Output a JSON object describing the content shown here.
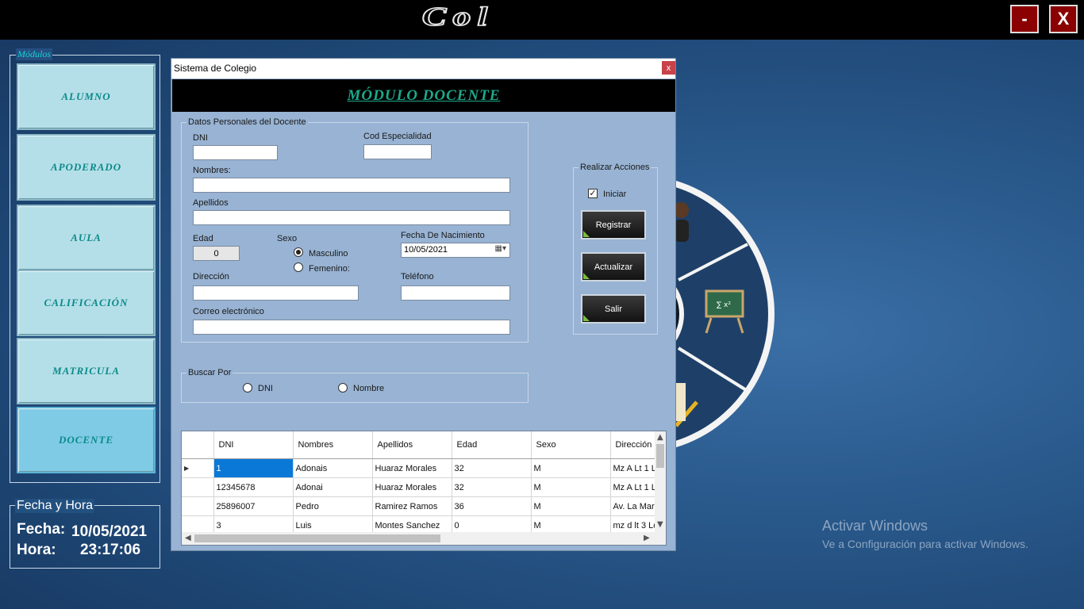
{
  "app": {
    "logo_text": "Col",
    "minimize_label": "-",
    "close_label": "X"
  },
  "sidebar": {
    "legend": "Módulos",
    "items": [
      {
        "label": "ALUMNO"
      },
      {
        "label": "APODERADO"
      },
      {
        "label": "AULA"
      },
      {
        "label": "CALIFICACIÓN"
      },
      {
        "label": "MATRICULA"
      },
      {
        "label": "DOCENTE"
      }
    ]
  },
  "datetime": {
    "legend": "Fecha y Hora",
    "date_label": "Fecha:",
    "date_value": "10/05/2021",
    "time_label": "Hora:",
    "time_value": "23:17:06"
  },
  "watermark": {
    "line1": "Activar Windows",
    "line2": "Ve a Configuración para activar Windows."
  },
  "dialog": {
    "title": "Sistema de Colegio",
    "close_label": "x",
    "banner": "MÓDULO DOCENTE",
    "personal": {
      "legend": "Datos Personales del Docente",
      "dni_label": "DNI",
      "dni_value": "",
      "cod_label": "Cod Especialidad",
      "cod_value": "",
      "nombres_label": "Nombres:",
      "nombres_value": "",
      "apellidos_label": "Apellidos",
      "apellidos_value": "",
      "edad_label": "Edad",
      "edad_value": "0",
      "sexo_label": "Sexo",
      "masculino_label": "Masculino",
      "femenino_label": "Femenino:",
      "fecha_label": "Fecha De Nacimiento",
      "fecha_value": "10/05/2021",
      "direccion_label": "Dirección",
      "direccion_value": "",
      "telefono_label": "Teléfono",
      "telefono_value": "",
      "correo_label": "Correo electrónico",
      "correo_value": ""
    },
    "actions": {
      "legend": "Realizar Acciones",
      "iniciar_label": "Iniciar",
      "iniciar_checked": true,
      "registrar": "Registrar",
      "actualizar": "Actualizar",
      "salir": "Salir"
    },
    "search": {
      "legend": "Buscar Por",
      "dni_label": "DNI",
      "nombre_label": "Nombre"
    },
    "grid": {
      "columns": [
        "DNI",
        "Nombres",
        "Apellidos",
        "Edad",
        "Sexo",
        "Dirección"
      ],
      "rows": [
        [
          "1",
          "Adonais",
          "Huaraz Morales",
          "32",
          "M",
          "Mz A Lt 1 L"
        ],
        [
          "12345678",
          "Adonai",
          "Huaraz Morales",
          "32",
          "M",
          "Mz A Lt 1 L"
        ],
        [
          "25896007",
          "Pedro",
          "Ramirez Ramos",
          "36",
          "M",
          "Av. La Mar"
        ],
        [
          "3",
          "Luis",
          "Montes Sanchez",
          "0",
          "M",
          "mz d lt 3 Lo"
        ]
      ]
    }
  }
}
